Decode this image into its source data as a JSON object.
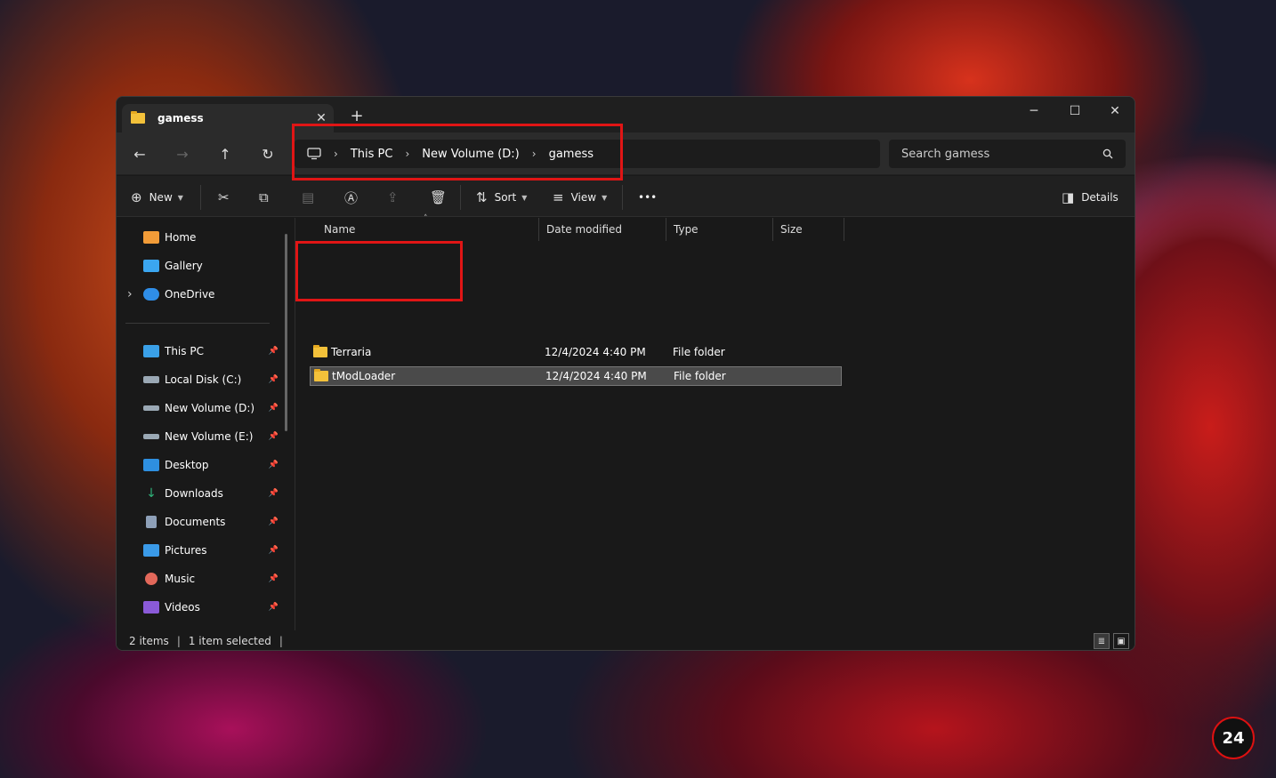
{
  "window": {
    "tab_title": "gamess",
    "tab_close": "✕",
    "new_tab": "+",
    "minimize": "─",
    "maximize": "☐",
    "close": "✕"
  },
  "nav": {
    "back": "←",
    "forward": "→",
    "up": "↑",
    "refresh": "↻",
    "breadcrumb": [
      "This PC",
      "New Volume (D:)",
      "gamess"
    ],
    "search_placeholder": "Search gamess"
  },
  "toolbar": {
    "new_label": "New",
    "sort_label": "Sort",
    "view_label": "View",
    "more": "•••",
    "details_label": "Details"
  },
  "sidebar": {
    "top": [
      {
        "label": "Home",
        "color": "#f29c38"
      },
      {
        "label": "Gallery",
        "color": "#3ba6f0"
      },
      {
        "label": "OneDrive",
        "color": "#2f8ee8"
      }
    ],
    "expand": "›",
    "pinned": [
      {
        "label": "This PC",
        "color": "#3aa0e8"
      },
      {
        "label": "Local Disk (C:)",
        "color": "#9aa8b4"
      },
      {
        "label": "New Volume (D:)",
        "color": "#9aa8b4"
      },
      {
        "label": "New Volume (E:)",
        "color": "#9aa8b4"
      },
      {
        "label": "Desktop",
        "color": "#2e8fe0"
      },
      {
        "label": "Downloads",
        "color": "#30b37a"
      },
      {
        "label": "Documents",
        "color": "#8ea0b8"
      },
      {
        "label": "Pictures",
        "color": "#3a9ae8"
      },
      {
        "label": "Music",
        "color": "#e2685a"
      },
      {
        "label": "Videos",
        "color": "#8a5ad8"
      }
    ],
    "pin_glyph": "📌"
  },
  "columns": {
    "name": "Name",
    "date": "Date modified",
    "type": "Type",
    "size": "Size"
  },
  "files": [
    {
      "name": "Terraria",
      "date": "12/4/2024 4:40 PM",
      "type": "File folder"
    },
    {
      "name": "tModLoader",
      "date": "12/4/2024 4:40 PM",
      "type": "File folder"
    }
  ],
  "status": {
    "items": "2 items",
    "selected": "1 item selected"
  },
  "logo_text": "24",
  "colors": {
    "highlight": "#e01515",
    "selection": "#4a4a4a",
    "folder": "#f3c13a"
  }
}
